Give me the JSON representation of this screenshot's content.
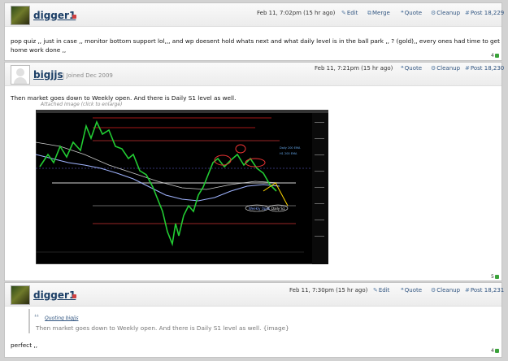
{
  "posts": [
    {
      "username": "digger1",
      "joined": "",
      "timestamp": "Feb 11, 7:02pm (15 hr ago)",
      "actions": {
        "edit": "Edit",
        "merge": "Merge",
        "quote": "Quote",
        "cleanup": "Cleanup",
        "post_number": "Post 18,229"
      },
      "body_line1": "pop quiz ,, just in case ,, monitor bottom support lol,,, and wp doesent hold whats next and what daily level is in the ball park ,, ? (gold),, every ones had time to get",
      "body_line2": "home work done ,,",
      "votes": "4"
    },
    {
      "username": "bigjjs",
      "joined": "| Joined Dec 2009",
      "timestamp": "Feb 11, 7:21pm (15 hr ago)",
      "actions": {
        "quote": "Quote",
        "cleanup": "Cleanup",
        "post_number": "Post 18,230"
      },
      "body_line1": "Then market goes down to Weekly open. And there is Daily S1 level as well.",
      "attachment_caption": "Attached Image (click to enlarge)",
      "votes": "5"
    },
    {
      "username": "digger1",
      "timestamp": "Feb 11, 7:30pm (15 hr ago)",
      "actions": {
        "edit": "Edit",
        "quote": "Quote",
        "cleanup": "Cleanup",
        "post_number": "Post 18,231"
      },
      "quote_author": "Quoting bigjjs",
      "quote_text": "Then market goes down to Weekly open. And there is Daily S1 level as well. {image}",
      "body_line1": "perfect ,,",
      "votes": "4"
    }
  ],
  "chart_labels": {
    "daily_s1": "Daily S1",
    "weekly_open": "Weekly Open",
    "daily_200": "Daily 200 EMA",
    "h1_200": "H1 200 EMA"
  },
  "colors": {
    "link": "#1b3e66",
    "chart_bg": "#000000",
    "candle": "#22cc33"
  }
}
